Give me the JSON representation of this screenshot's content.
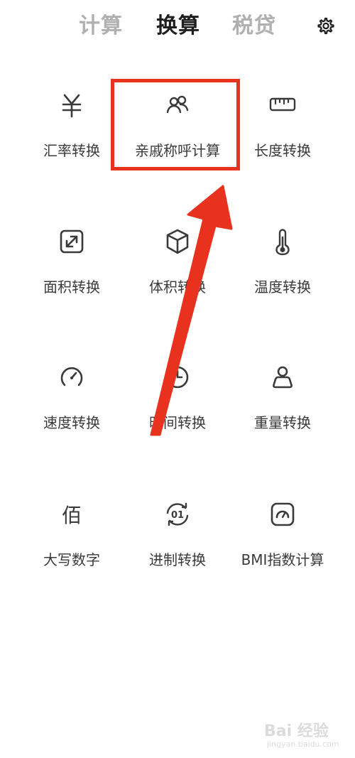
{
  "tabs": {
    "calc": "计算",
    "convert": "换算",
    "tax": "税贷"
  },
  "items": {
    "exchange": "汇率转换",
    "relative": "亲戚称呼计算",
    "length": "长度转换",
    "area": "面积转换",
    "volume": "体积转换",
    "temperature": "温度转换",
    "speed": "速度转换",
    "time": "时间转换",
    "weight": "重量转换",
    "capital": "大写数字",
    "base": "进制转换",
    "bmi": "BMI指数计算"
  },
  "icons": {
    "exchange": "yen-icon",
    "relative": "people-icon",
    "length": "ruler-icon",
    "area": "expand-square-icon",
    "volume": "cube-icon",
    "temperature": "thermometer-icon",
    "speed": "speedometer-icon",
    "time": "clock-icon",
    "weight": "weight-icon",
    "capital": "bai-char-icon",
    "base": "binary-rotate-icon",
    "bmi": "bmi-gauge-icon",
    "settings": "gear-icon"
  },
  "icon_glyphs": {
    "capital": "佰",
    "base": "01"
  },
  "colors": {
    "highlight": "#e8321e",
    "active_tab": "#1e1e1e",
    "inactive_tab": "#b0b0b0"
  },
  "watermark": {
    "text": "Bai 经验",
    "sub": "jingyan.baidu.com"
  }
}
